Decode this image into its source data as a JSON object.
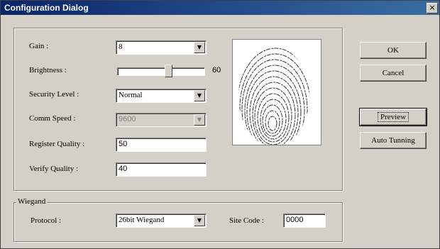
{
  "window": {
    "title": "Configuration Dialog",
    "close_glyph": "×"
  },
  "settings": {
    "gain": {
      "label": "Gain :",
      "value": "8"
    },
    "brightness": {
      "label": "Brightness :",
      "value": "60",
      "level": 0.6
    },
    "security_level": {
      "label": "Security Level :",
      "value": "Normal"
    },
    "comm_speed": {
      "label": "Comm Speed :",
      "value": "9600"
    },
    "register_quality": {
      "label": "Register Quality :",
      "value": "50"
    },
    "verify_quality": {
      "label": "Verify Quality :",
      "value": "40"
    }
  },
  "wiegand": {
    "group_label": "Wiegand",
    "protocol_label": "Protocol :",
    "protocol_value": "26bit Wiegand",
    "site_code_label": "Site Code :",
    "site_code_value": "0000"
  },
  "buttons": {
    "ok": "OK",
    "cancel": "Cancel",
    "preview": "Preview",
    "auto_tuning": "Auto Tunning"
  },
  "icons": {
    "dropdown": "chevron-down-icon",
    "close": "close-icon",
    "fingerprint": "fingerprint-image"
  }
}
